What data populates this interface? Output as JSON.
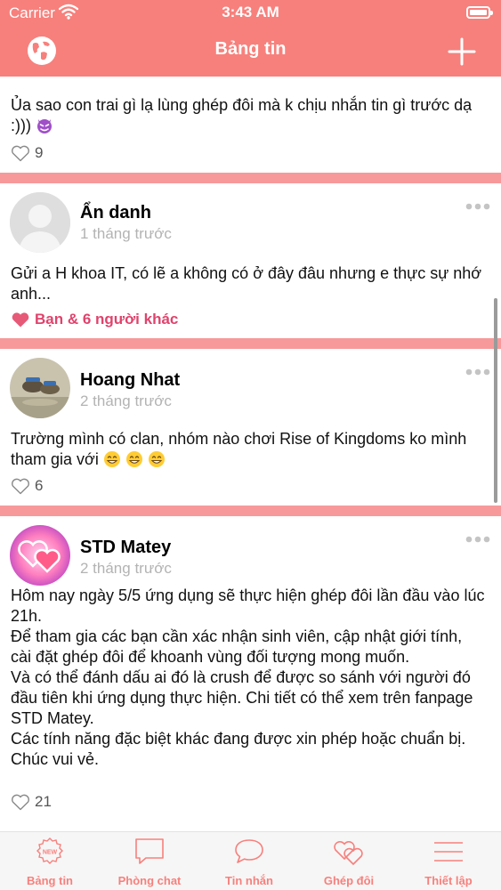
{
  "status_bar": {
    "carrier": "Carrier",
    "time": "3:43 AM"
  },
  "header": {
    "title": "Bảng tin",
    "left_icon": "globe-icon",
    "right_icon": "plus-icon"
  },
  "colors": {
    "accent": "#f7807c",
    "separator": "#f7999a",
    "liked": "#e0436c"
  },
  "posts": [
    {
      "content": "Ủa sao con trai gì lạ lùng ghép đôi mà k chịu nhắn tin gì trước dạ :)))",
      "emoji": "devil-emoji",
      "likes": "9"
    },
    {
      "name": "Ẩn danh",
      "time": "1 tháng trước",
      "content": "Gửi a H khoa IT, có lẽ a không có ở đây đâu nhưng e thực sự nhớ anh...",
      "likes": "Bạn & 6 người khác",
      "liked": true
    },
    {
      "name": "Hoang Nhat",
      "time": "2 tháng trước",
      "content": "Trường mình có clan, nhóm nào chơi Rise of Kingdoms ko mình tham gia với",
      "emoji": "grin-emoji",
      "likes": "6"
    },
    {
      "name": "STD Matey",
      "time": "2 tháng trước",
      "content": "Hôm nay ngày 5/5 ứng dụng sẽ thực hiện ghép đôi lần đầu vào lúc 21h.\nĐể tham gia các bạn cần xác nhận sinh viên, cập nhật giới tính, cài đặt ghép đôi để khoanh vùng đối tượng mong muốn.\nVà có thể đánh dấu ai đó là crush để được so sánh với người đó đầu tiên khi ứng dụng thực hiện. Chi tiết có thể xem trên fanpage STD Matey.\nCác tính năng đặc biệt khác đang được xin phép hoặc chuẩn bị.\nChúc vui vẻ.",
      "likes": "21"
    }
  ],
  "tabs": [
    {
      "label": "Bảng tin",
      "icon": "news-icon",
      "badge": "NEW"
    },
    {
      "label": "Phòng chat",
      "icon": "chat-room-icon"
    },
    {
      "label": "Tin nhắn",
      "icon": "message-bubble-icon"
    },
    {
      "label": "Ghép đôi",
      "icon": "hearts-icon"
    },
    {
      "label": "Thiết lập",
      "icon": "menu-icon"
    }
  ]
}
